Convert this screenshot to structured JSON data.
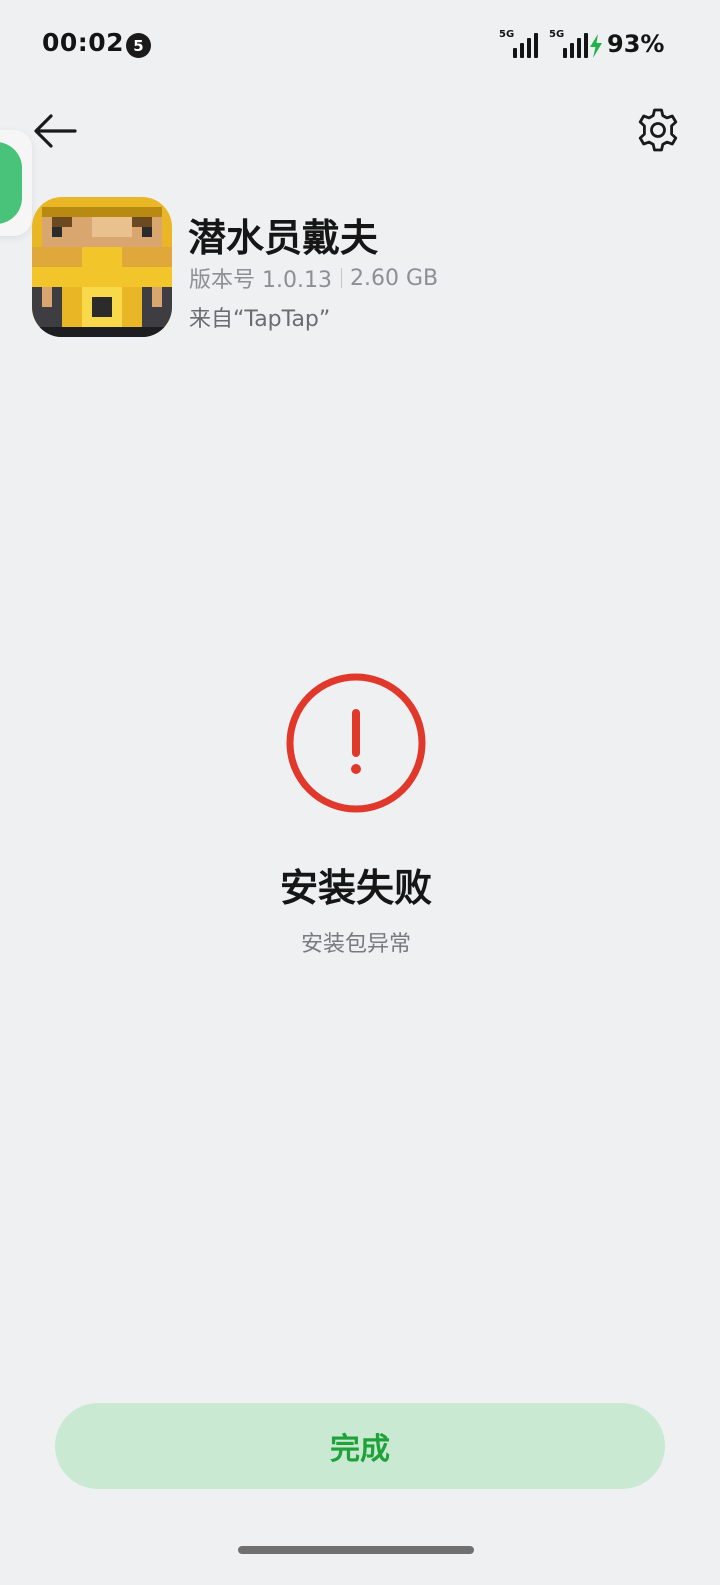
{
  "status_bar": {
    "time": "00:02",
    "notification_count": "5",
    "network_1": "5G",
    "network_2": "5G",
    "battery": "93%"
  },
  "header": {
    "back_icon": "arrow-left-icon",
    "settings_icon": "gear-icon"
  },
  "app": {
    "name": "潜水员戴夫",
    "version": "版本号 1.0.13",
    "size": "2.60 GB",
    "source": "来自“TapTap”"
  },
  "result": {
    "icon": "exclamation-circle-icon",
    "title": "安装失败",
    "subtitle": "安装包异常",
    "icon_color": "#e0392b"
  },
  "actions": {
    "done_label": "完成",
    "done_text_color": "#1fa23a",
    "done_bg_color": "#cae9d2"
  }
}
